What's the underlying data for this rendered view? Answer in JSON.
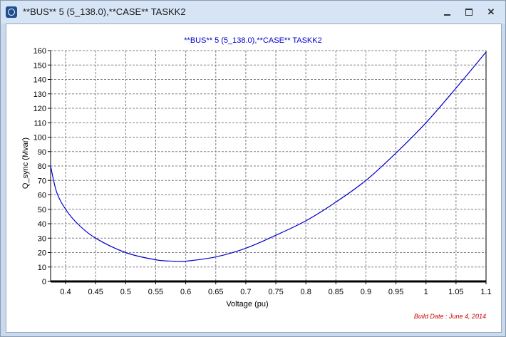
{
  "window": {
    "title": "**BUS** 5 (5_138.0),**CASE** TASKK2"
  },
  "chart_data": {
    "type": "line",
    "title": "**BUS** 5 (5_138.0),**CASE** TASKK2",
    "xlabel": "Voltage (pu)",
    "ylabel": "Q_sync (Mvar)",
    "xlim": [
      0.375,
      1.1
    ],
    "ylim": [
      0,
      160
    ],
    "xticks": [
      "0.4",
      "0.45",
      "0.5",
      "0.55",
      "0.6",
      "0.65",
      "0.7",
      "0.75",
      "0.8",
      "0.85",
      "0.9",
      "0.95",
      "1",
      "1.05",
      "1.1"
    ],
    "yticks": [
      "0",
      "10",
      "20",
      "30",
      "40",
      "50",
      "60",
      "70",
      "80",
      "90",
      "100",
      "110",
      "120",
      "130",
      "140",
      "150",
      "160"
    ],
    "grid": true,
    "series": [
      {
        "color": "#0000cc",
        "x": [
          0.375,
          0.385,
          0.4,
          0.42,
          0.45,
          0.5,
          0.55,
          0.58,
          0.6,
          0.65,
          0.7,
          0.75,
          0.8,
          0.85,
          0.9,
          0.95,
          1.0,
          1.05,
          1.1
        ],
        "y": [
          80,
          62,
          50,
          40,
          30,
          20,
          15,
          14,
          14,
          17,
          23,
          32,
          42,
          55,
          70,
          89,
          110,
          134,
          159
        ]
      }
    ],
    "footer": "Build Date : June 4, 2014"
  },
  "colors": {
    "line": "#0000cc",
    "title": "#0000cc",
    "footer": "#cc0000",
    "axis": "#000000",
    "grid": "#808080"
  }
}
